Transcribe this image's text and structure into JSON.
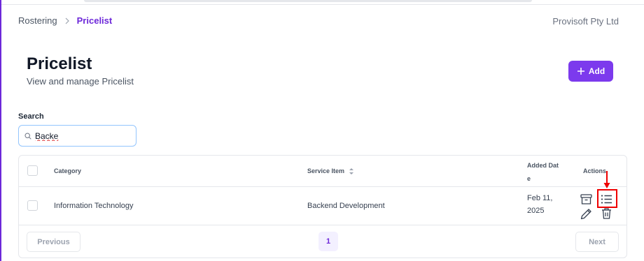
{
  "breadcrumb": {
    "root": "Rostering",
    "current": "Pricelist"
  },
  "company": "Provisoft Pty Ltd",
  "page": {
    "title": "Pricelist",
    "subtitle": "View and manage Pricelist"
  },
  "add_button": {
    "label": "Add"
  },
  "search": {
    "label": "Search",
    "value": "Backe"
  },
  "table": {
    "columns": {
      "category": "Category",
      "service_item": "Service Item",
      "added_date": "Added Date",
      "actions": "Actions"
    },
    "rows": [
      {
        "category": "Information Technology",
        "service_item": "Backend Development",
        "added_date": "Feb 11, 2025"
      }
    ]
  },
  "pagination": {
    "previous": "Previous",
    "page": "1",
    "next": "Next"
  },
  "colors": {
    "accent": "#7c3aed",
    "highlight": "#ef0000"
  },
  "icons": [
    "chevron-right-icon",
    "plus-icon",
    "search-icon",
    "sort-icon",
    "archive-icon",
    "list-icon",
    "edit-icon",
    "trash-icon"
  ]
}
